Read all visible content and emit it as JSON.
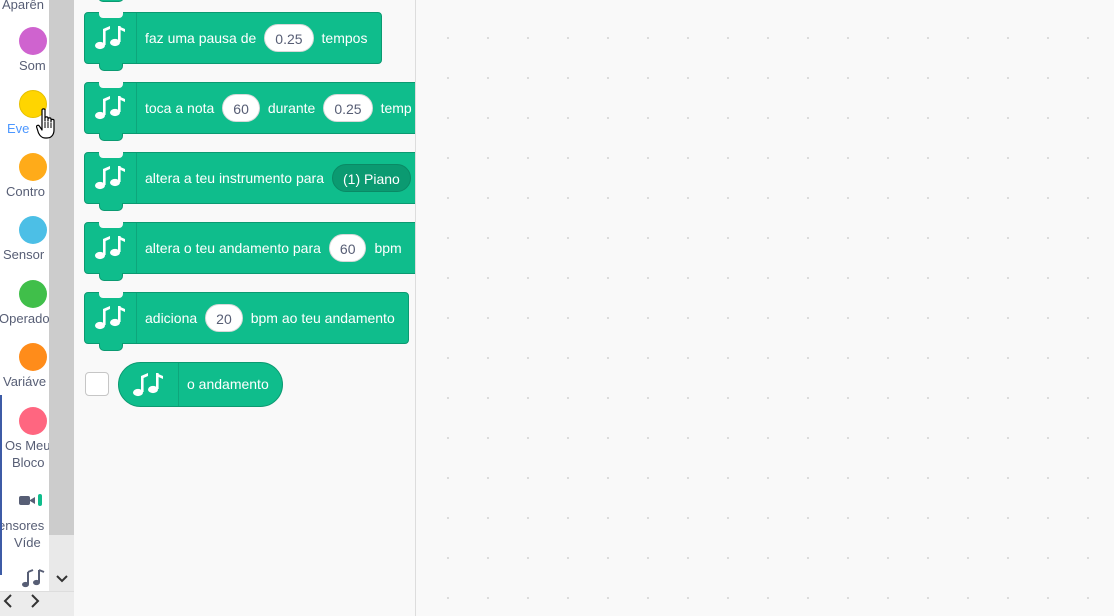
{
  "categories": [
    {
      "label": "Aparên",
      "color": ""
    },
    {
      "label": "Som",
      "color": "#cf63cf"
    },
    {
      "label": "Eve",
      "color": "#ffd500"
    },
    {
      "label": "Contro",
      "color": "#ffab19"
    },
    {
      "label": "Sensor",
      "color": "#4cbfe6"
    },
    {
      "label": "Operado",
      "color": "#40bf4a"
    },
    {
      "label": "Variáve",
      "color": "#ff8c1a"
    },
    {
      "label_line1": "Os Meu",
      "label_line2": "Bloco",
      "color": "#ff6680"
    },
    {
      "label_line1": "ensores",
      "label_line2": "Víde",
      "icon": "video-camera-icon"
    },
    {
      "icon": "music-notes-icon"
    }
  ],
  "blocks": [
    {
      "text1": "faz uma pausa de",
      "value1": "0.25",
      "text2": "tempos"
    },
    {
      "text1": "toca a nota",
      "value1": "60",
      "text2": "durante",
      "value2": "0.25",
      "text3": "temp"
    },
    {
      "text1": "altera a teu instrumento para",
      "dropdown": "(1) Piano"
    },
    {
      "text1": "altera o teu andamento para",
      "value1": "60",
      "text2": "bpm"
    },
    {
      "text1": "adiciona",
      "value1": "20",
      "text2": "bpm ao teu andamento"
    }
  ],
  "reporter": {
    "label": "o andamento"
  },
  "colors": {
    "music": "#0fbd8c",
    "music_dark": "#0b9a71",
    "active_label": "#4c97ff"
  }
}
